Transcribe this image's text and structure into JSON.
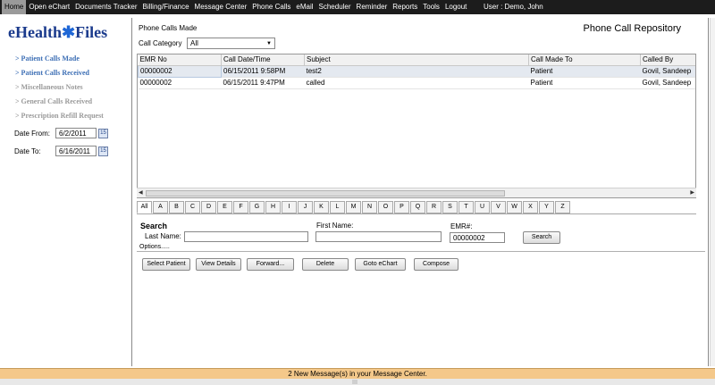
{
  "menu": {
    "items": [
      "Home",
      "Open eChart",
      "Documents Tracker",
      "Billing/Finance",
      "Message Center",
      "Phone Calls",
      "eMail",
      "Scheduler",
      "Reminder",
      "Reports",
      "Tools",
      "Logout"
    ],
    "user": "User : Demo,  John"
  },
  "left": {
    "logo_left": "eHealth",
    "logo_right": "Files",
    "logo_star": "✱",
    "nav": [
      {
        "label": "> Patient Calls Made",
        "state": "on"
      },
      {
        "label": "> Patient Calls Received",
        "state": "on"
      },
      {
        "label": "> Miscellaneous Notes",
        "state": "off"
      },
      {
        "label": "> General Calls Received",
        "state": "off"
      },
      {
        "label": "> Prescription Refill Request",
        "state": "off"
      }
    ],
    "date_from_label": "Date From:",
    "date_from": "6/2/2011",
    "date_to_label": "Date To:",
    "date_to": "6/16/2011",
    "calendar_text": "15"
  },
  "main": {
    "section_title": "Phone Calls Made",
    "repo_title": "Phone Call Repository",
    "category_label": "Call Category",
    "category_value": "All",
    "select_arrow": "▼",
    "columns": [
      "EMR No",
      "Call Date/Time",
      "Subject",
      "Call Made To",
      "Called By"
    ],
    "rows": [
      [
        "00000002",
        "06/15/2011  9:58PM",
        "test2",
        "Patient",
        "Govil, Sandeep"
      ],
      [
        "00000002",
        "06/15/2011  9:47PM",
        "called",
        "Patient",
        "Govil, Sandeep"
      ]
    ],
    "scroll_left": "◀",
    "scroll_right": "▶",
    "alphabet": [
      "All",
      "A",
      "B",
      "C",
      "D",
      "E",
      "F",
      "G",
      "H",
      "I",
      "J",
      "K",
      "L",
      "M",
      "N",
      "O",
      "P",
      "Q",
      "R",
      "S",
      "T",
      "U",
      "V",
      "W",
      "X",
      "Y",
      "Z"
    ],
    "search": {
      "title": "Search",
      "last_name_label": "Last Name:",
      "last_name_value": "",
      "first_name_label": "First Name:",
      "first_name_value": "",
      "emr_label": "EMR#:",
      "emr_value": "00000002",
      "search_button": "Search",
      "options_link": "Options....."
    },
    "actions": [
      "Select Patient",
      "View Details",
      "Forward...",
      "Delete",
      "Goto eChart",
      "Compose"
    ]
  },
  "status": {
    "message": "2 New Message(s) in your Message Center."
  }
}
